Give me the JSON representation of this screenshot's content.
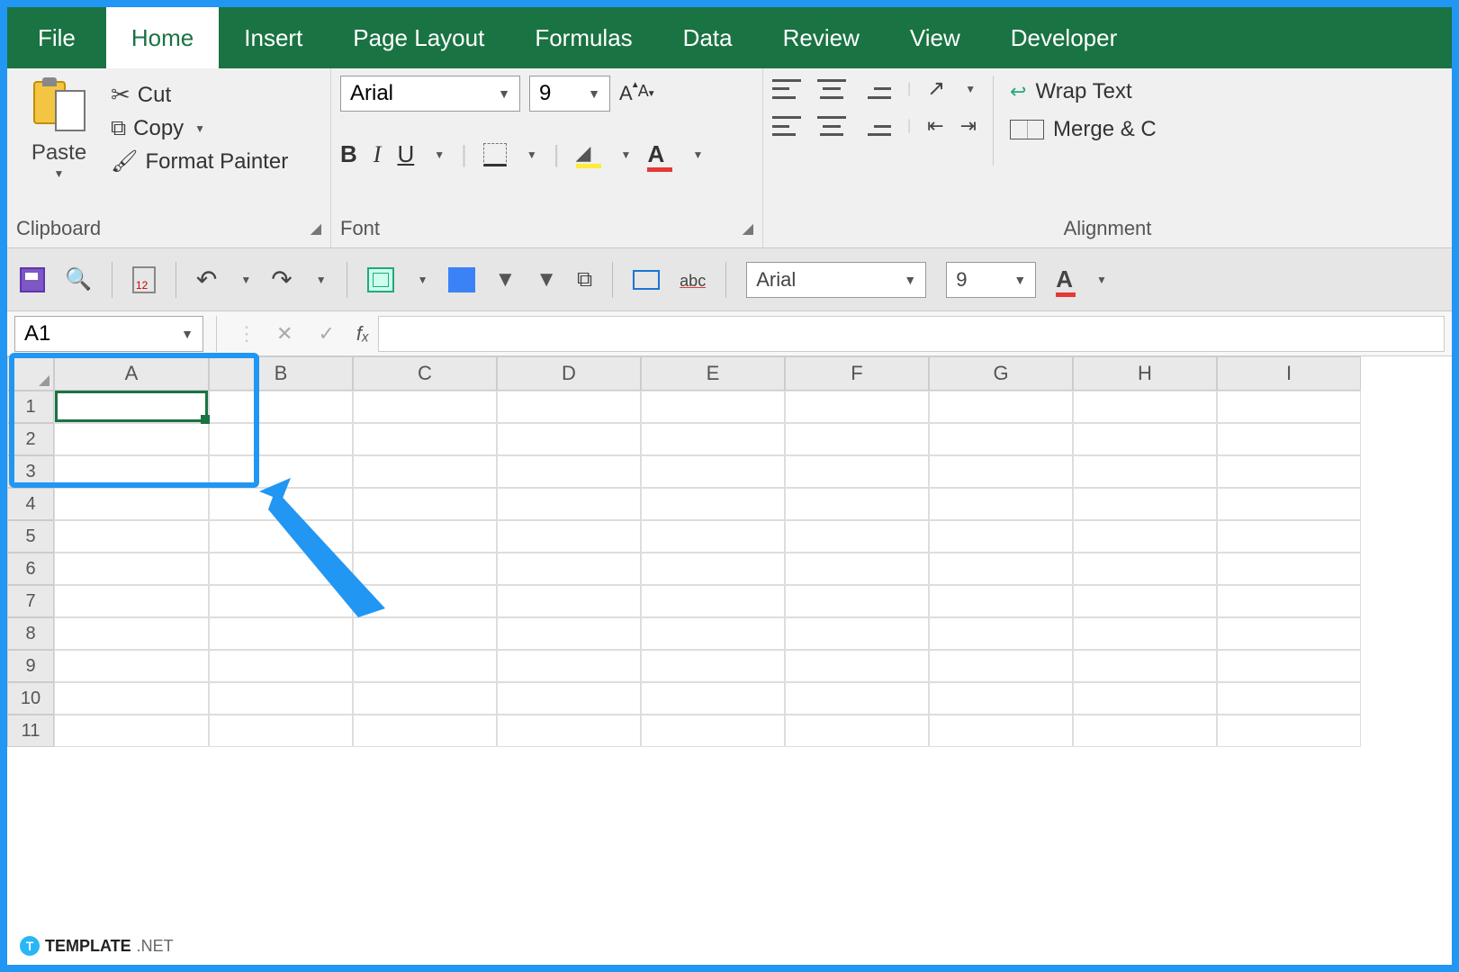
{
  "tabs": [
    "File",
    "Home",
    "Insert",
    "Page Layout",
    "Formulas",
    "Data",
    "Review",
    "View",
    "Developer"
  ],
  "active_tab": "Home",
  "clipboard": {
    "paste": "Paste",
    "cut": "Cut",
    "copy": "Copy",
    "format_painter": "Format Painter",
    "group_label": "Clipboard"
  },
  "font": {
    "name": "Arial",
    "size": "9",
    "bold": "B",
    "italic": "I",
    "underline": "U",
    "increase": "A",
    "decrease": "A",
    "fontcolor_letter": "A",
    "group_label": "Font"
  },
  "alignment": {
    "wrap": "Wrap Text",
    "merge": "Merge & C",
    "group_label": "Alignment"
  },
  "qat": {
    "font": "Arial",
    "size": "9",
    "fc_letter": "A"
  },
  "name_box": "A1",
  "fx_label": "fₓ",
  "columns": [
    "A",
    "B",
    "C",
    "D",
    "E",
    "F",
    "G",
    "H",
    "I"
  ],
  "rows": [
    "1",
    "2",
    "3",
    "4",
    "5",
    "6",
    "7",
    "8",
    "9",
    "10",
    "11"
  ],
  "watermark": {
    "brand": "TEMPLATE",
    "suffix": ".NET",
    "t": "T"
  }
}
